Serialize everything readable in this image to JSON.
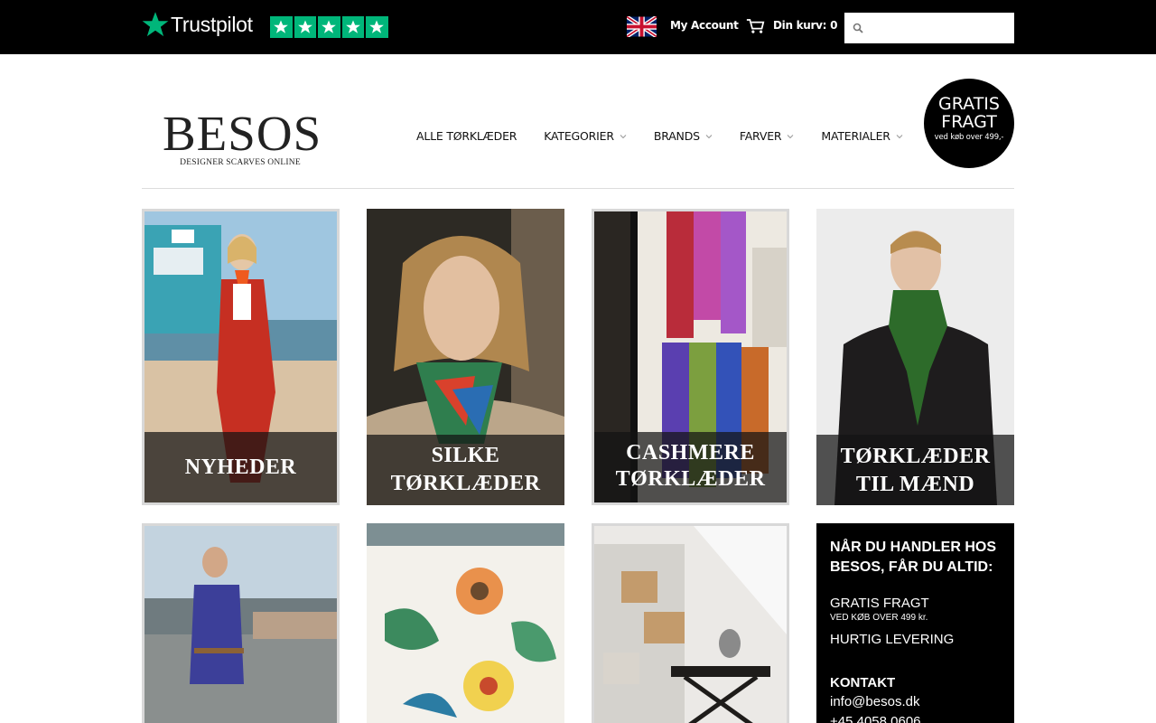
{
  "topbar": {
    "trustpilot_wordmark": "Trustpilot",
    "account_label": "My Account",
    "cart_label": "Din kurv:",
    "cart_count": "0",
    "search_placeholder": "",
    "language_flag": "uk-flag-icon"
  },
  "logo": {
    "title": "BESOS",
    "tagline": "DESIGNER SCARVES ONLINE"
  },
  "nav": {
    "items": [
      {
        "label": "ALLE TØRKLÆDER",
        "dropdown": false
      },
      {
        "label": "KATEGORIER",
        "dropdown": true
      },
      {
        "label": "BRANDS",
        "dropdown": true
      },
      {
        "label": "FARVER",
        "dropdown": true
      },
      {
        "label": "MATERIALER",
        "dropdown": true
      }
    ]
  },
  "badge": {
    "line1": "GRATIS",
    "line2": "FRAGT",
    "line3": "ved køb over 499,-"
  },
  "tiles": [
    {
      "caption_lines": [
        "NYHEDER"
      ]
    },
    {
      "caption_lines": [
        "SILKE",
        "TØRKLÆDER"
      ]
    },
    {
      "caption_lines": [
        "CASHMERE",
        "TØRKLÆDER"
      ]
    },
    {
      "caption_lines": [
        "TØRKLÆDER",
        "TIL MÆND"
      ]
    }
  ],
  "info": {
    "heading": "NÅR DU HANDLER HOS BESOS, FÅR DU ALTID:",
    "benefit1": "GRATIS FRAGT",
    "benefit1_sub": "VED KØB OVER 499 kr.",
    "benefit2": "HURTIG LEVERING",
    "contact_heading": "KONTAKT",
    "email": "info@besos.dk",
    "phone": "+45 4058 0606"
  },
  "colors": {
    "topbar_bg": "#000000",
    "trustpilot_green": "#00b67a",
    "accent_dark": "#000000"
  }
}
